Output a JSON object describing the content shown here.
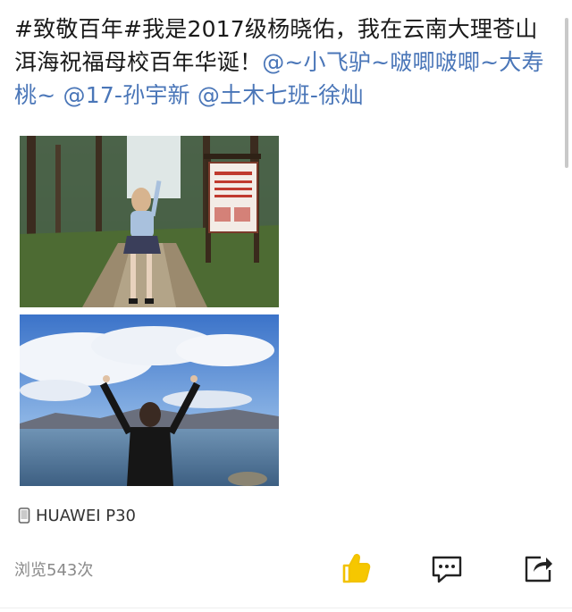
{
  "post": {
    "text_plain_1": "#致敬百年#我是2017级杨晓佑，我在云南大理苍山洱海祝福母校百年华诞！",
    "mention_1": "@~小飞驴~啵唧啵唧~大寿桃~",
    "mention_2": "@17-孙宇新",
    "mention_3": "@土木七班-徐灿"
  },
  "device": {
    "label": "HUAWEI P30",
    "icon": "phone-icon"
  },
  "footer": {
    "views": "浏览543次",
    "like_icon": "thumbs-up-icon",
    "comment_icon": "comment-icon",
    "share_icon": "share-icon"
  },
  "colors": {
    "mention": "#4a76b8",
    "like": "#f6c700",
    "text": "#1a1a1a",
    "muted": "#8a8a8a"
  }
}
